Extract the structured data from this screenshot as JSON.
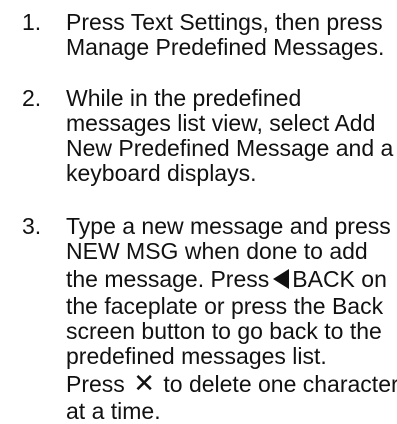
{
  "steps": [
    {
      "number": "1.",
      "lines": [
        "Press Text Settings, then press",
        "Manage Predefined Messages."
      ]
    },
    {
      "number": "2.",
      "lines": [
        "While in the predefined",
        "messages list view, select Add",
        "New Predefined Message and a",
        "keyboard displays."
      ]
    },
    {
      "number": "3.",
      "lines": [
        "Type a new message and press",
        "NEW MSG when done to add",
        "the message. Press",
        "BACK on",
        "the faceplate or press the Back",
        "screen button to go back to the",
        "predefined messages list.",
        "Press",
        "to delete one character",
        "at a time."
      ]
    }
  ],
  "icons": {
    "back": "back-triangle-icon",
    "delete": "delete-x-icon"
  }
}
